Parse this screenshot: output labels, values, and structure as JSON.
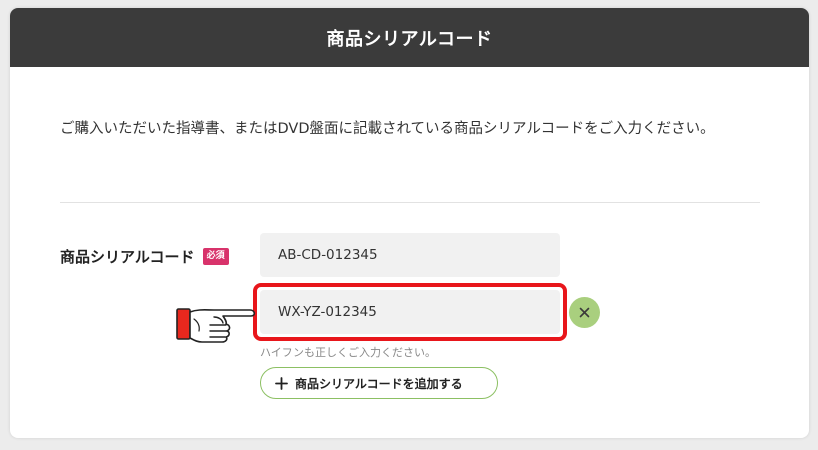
{
  "header": {
    "title": "商品シリアルコード"
  },
  "description": "ご購入いただいた指導書、またはDVD盤面に記載されている商品シリアルコードをご入力ください。",
  "field": {
    "label": "商品シリアルコード",
    "required_badge": "必須",
    "inputs": [
      {
        "value": "AB-CD-012345"
      },
      {
        "value": "WX-YZ-012345"
      }
    ],
    "hint": "ハイフンも正しくご入力ください。",
    "add_button_label": "商品シリアルコードを追加する"
  },
  "colors": {
    "header_bg": "#3b3b3b",
    "required_badge": "#d8336b",
    "accent_green": "#8cc063",
    "highlight_red": "#e8161b"
  },
  "icons": {
    "clear": "close-icon",
    "add": "plus-icon",
    "pointer": "pointing-hand-icon"
  }
}
